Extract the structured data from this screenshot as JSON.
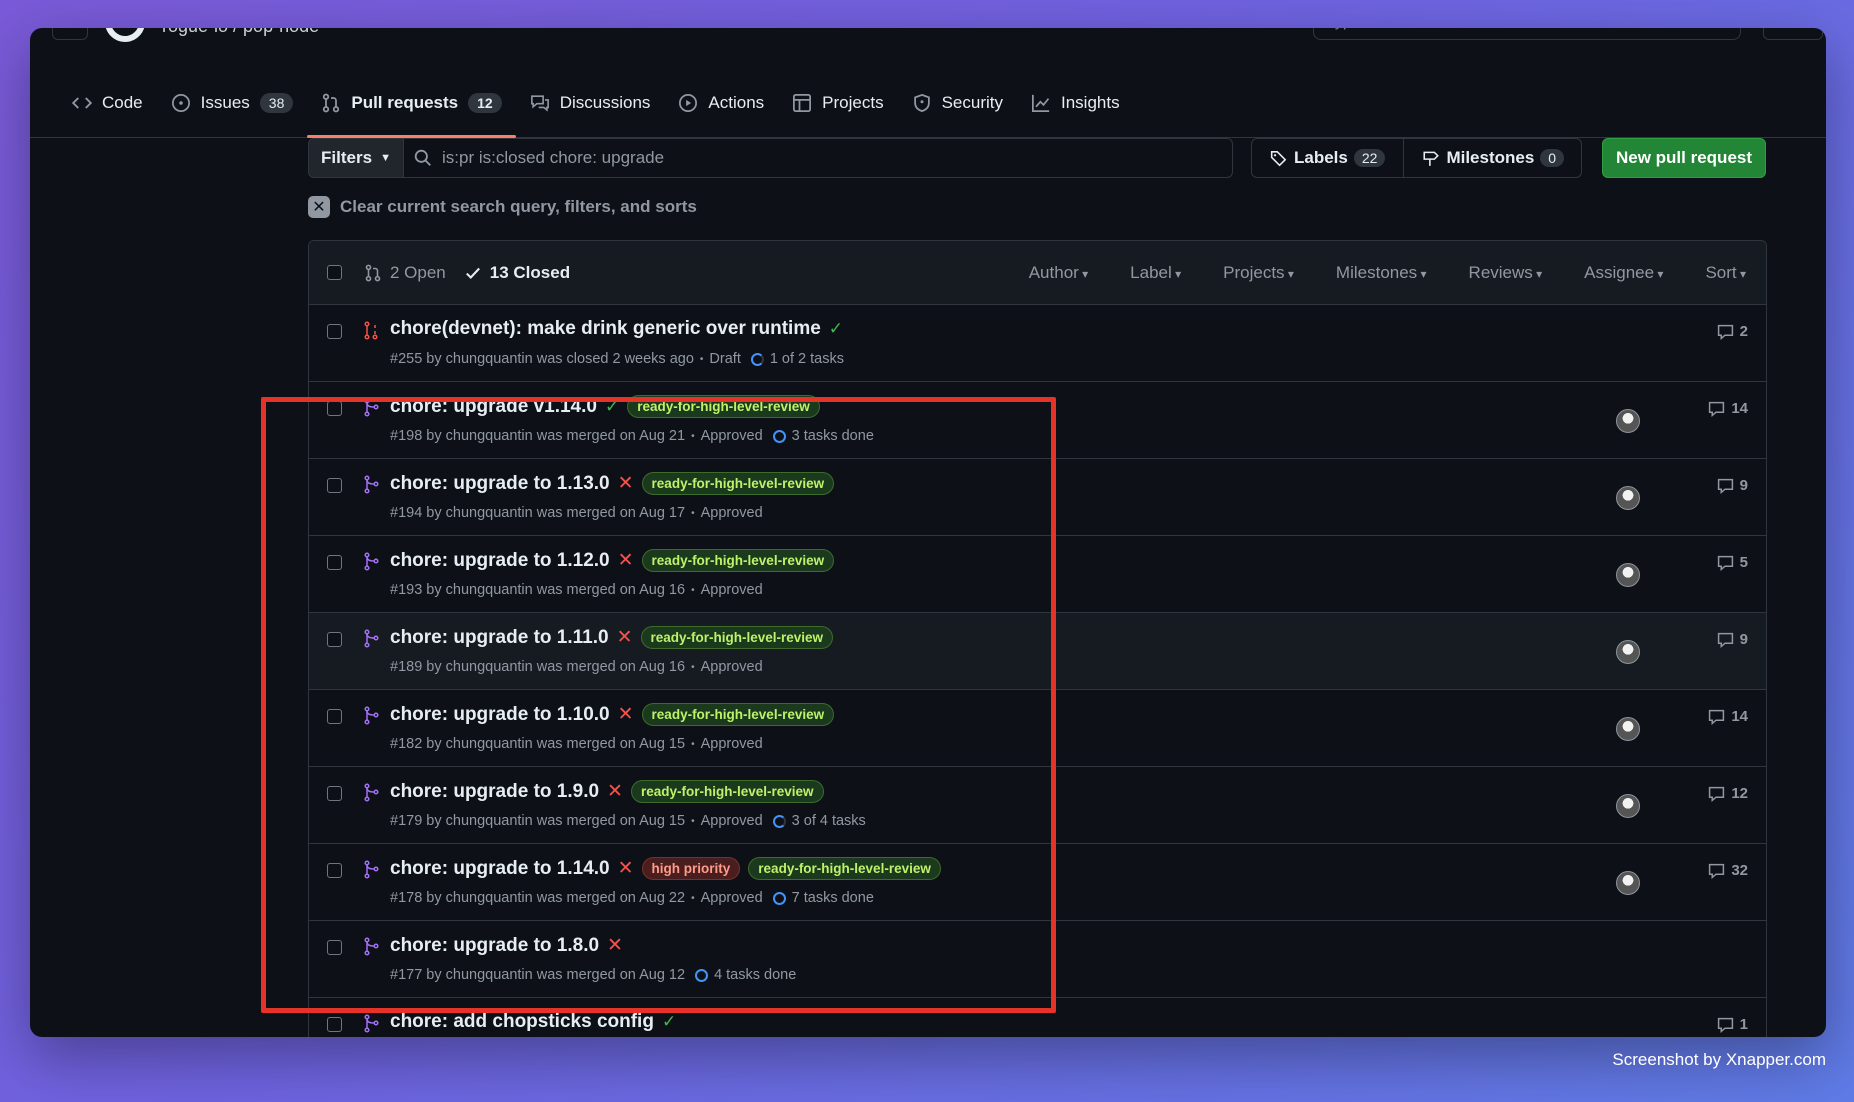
{
  "topbar": {
    "repo": "rogue-io / pop-node",
    "search_placeholder": "Type / to search"
  },
  "nav": {
    "tabs": [
      {
        "label": "Code",
        "icon": "code-icon"
      },
      {
        "label": "Issues",
        "count": "38",
        "icon": "issue-icon"
      },
      {
        "label": "Pull requests",
        "count": "12",
        "icon": "pull-request-icon",
        "active": true
      },
      {
        "label": "Discussions",
        "icon": "discussion-icon"
      },
      {
        "label": "Actions",
        "icon": "play-icon"
      },
      {
        "label": "Projects",
        "icon": "table-icon"
      },
      {
        "label": "Security",
        "icon": "shield-icon"
      },
      {
        "label": "Insights",
        "icon": "graph-icon"
      }
    ]
  },
  "filters": {
    "filters_label": "Filters",
    "query": "is:pr is:closed chore: upgrade",
    "labels_label": "Labels",
    "labels_count": "22",
    "milestones_label": "Milestones",
    "milestones_count": "0",
    "new_pr_label": "New pull request",
    "clear_text": "Clear current search query, filters, and sorts"
  },
  "list_header": {
    "open_label": "2 Open",
    "closed_label": "13 Closed",
    "sorts": [
      "Author",
      "Label",
      "Projects",
      "Milestones",
      "Reviews",
      "Assignee",
      "Sort"
    ]
  },
  "prs": [
    {
      "title": "chore(devnet): make drink generic over runtime",
      "status": "check",
      "labels": [],
      "meta": "#255 by chungquantin was closed 2 weeks ago",
      "extra": "Draft",
      "tasks": "1 of 2 tasks",
      "tasks_partial": true,
      "comments": "2",
      "avatar": false,
      "kind": "closed"
    },
    {
      "title": "chore: upgrade v1.14.0",
      "status": "check",
      "labels": [
        {
          "text": "ready-for-high-level-review",
          "color": "green"
        }
      ],
      "meta": "#198 by chungquantin was merged on Aug 21",
      "extra": "Approved",
      "tasks": "3 tasks done",
      "tasks_partial": false,
      "comments": "14",
      "avatar": true,
      "kind": "merged"
    },
    {
      "title": "chore: upgrade to 1.13.0",
      "status": "x",
      "labels": [
        {
          "text": "ready-for-high-level-review",
          "color": "green"
        }
      ],
      "meta": "#194 by chungquantin was merged on Aug 17",
      "extra": "Approved",
      "tasks": "",
      "comments": "9",
      "avatar": true,
      "kind": "merged"
    },
    {
      "title": "chore: upgrade to 1.12.0",
      "status": "x",
      "labels": [
        {
          "text": "ready-for-high-level-review",
          "color": "green"
        }
      ],
      "meta": "#193 by chungquantin was merged on Aug 16",
      "extra": "Approved",
      "tasks": "",
      "comments": "5",
      "avatar": true,
      "kind": "merged"
    },
    {
      "title": "chore: upgrade to 1.11.0",
      "status": "x",
      "labels": [
        {
          "text": "ready-for-high-level-review",
          "color": "green"
        }
      ],
      "meta": "#189 by chungquantin was merged on Aug 16",
      "extra": "Approved",
      "tasks": "",
      "comments": "9",
      "avatar": true,
      "kind": "merged"
    },
    {
      "title": "chore: upgrade to 1.10.0",
      "status": "x",
      "labels": [
        {
          "text": "ready-for-high-level-review",
          "color": "green"
        }
      ],
      "meta": "#182 by chungquantin was merged on Aug 15",
      "extra": "Approved",
      "tasks": "",
      "comments": "14",
      "avatar": true,
      "kind": "merged"
    },
    {
      "title": "chore: upgrade to 1.9.0",
      "status": "x",
      "labels": [
        {
          "text": "ready-for-high-level-review",
          "color": "green"
        }
      ],
      "meta": "#179 by chungquantin was merged on Aug 15",
      "extra": "Approved",
      "tasks": "3 of 4 tasks",
      "tasks_partial": true,
      "comments": "12",
      "avatar": true,
      "kind": "merged"
    },
    {
      "title": "chore: upgrade to 1.14.0",
      "status": "x",
      "labels": [
        {
          "text": "high priority",
          "color": "red"
        },
        {
          "text": "ready-for-high-level-review",
          "color": "green"
        }
      ],
      "meta": "#178 by chungquantin was merged on Aug 22",
      "extra": "Approved",
      "tasks": "7 tasks done",
      "tasks_partial": false,
      "comments": "32",
      "avatar": true,
      "kind": "merged"
    },
    {
      "title": "chore: upgrade to 1.8.0",
      "status": "x",
      "labels": [],
      "meta": "#177 by chungquantin was merged on Aug 12",
      "extra": "",
      "tasks": "4 tasks done",
      "tasks_partial": false,
      "comments": "",
      "avatar": false,
      "kind": "merged"
    },
    {
      "title": "chore: add chopsticks config",
      "status": "check",
      "labels": [],
      "meta": "",
      "extra": "",
      "tasks": "",
      "comments": "1",
      "avatar": false,
      "kind": "merged"
    }
  ],
  "credit": "Screenshot by Xnapper.com"
}
